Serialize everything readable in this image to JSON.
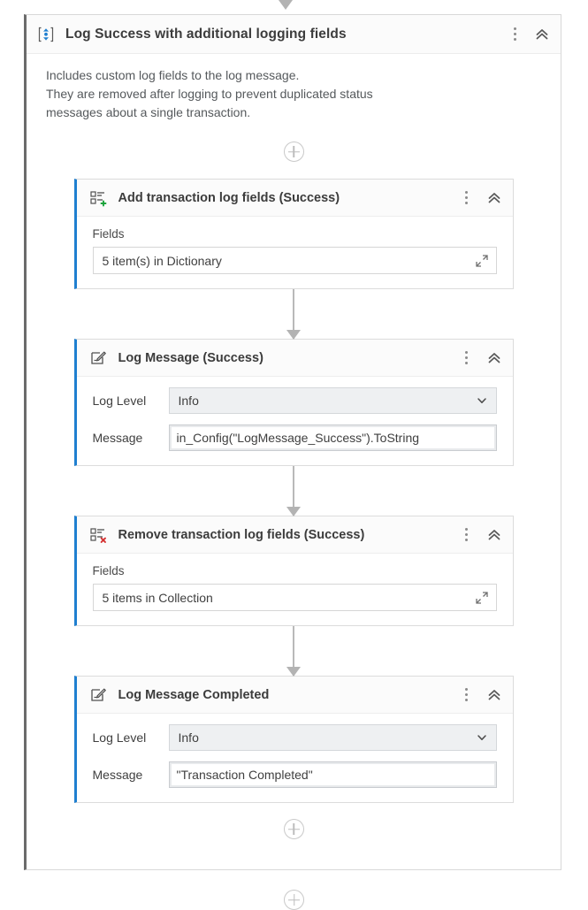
{
  "sequence": {
    "icon": "sequence-icon",
    "title": "Log Success with additional logging fields",
    "menu_icon": "kebab-menu-icon",
    "collapse_icon": "double-chevron-up-icon",
    "description_lines": [
      "Includes custom log fields to the log message.",
      "They are removed after logging to prevent duplicated status",
      "messages about a single transaction."
    ],
    "add_activity_label": "+"
  },
  "accent_color": "#1f7fd0",
  "activities": [
    {
      "id": "add-transaction-log-fields",
      "icon": "add-log-fields-icon",
      "title": "Add transaction log fields (Success)",
      "menu_icon": "kebab-menu-icon",
      "collapse_icon": "double-chevron-up-icon",
      "field_label": "Fields",
      "field_value": "5 item(s) in Dictionary",
      "expand_icon": "open-editor-icon"
    },
    {
      "id": "log-message-success",
      "icon": "log-message-icon",
      "title": "Log Message (Success)",
      "menu_icon": "kebab-menu-icon",
      "collapse_icon": "double-chevron-up-icon",
      "log_level_label": "Log Level",
      "log_level_value": "Info",
      "dropdown_icon": "chevron-down-icon",
      "message_label": "Message",
      "message_value": "in_Config(\"LogMessage_Success\").ToString"
    },
    {
      "id": "remove-transaction-log-fields",
      "icon": "remove-log-fields-icon",
      "title": "Remove transaction log fields (Success)",
      "menu_icon": "kebab-menu-icon",
      "collapse_icon": "double-chevron-up-icon",
      "field_label": "Fields",
      "field_value": "5 items in Collection",
      "expand_icon": "open-editor-icon"
    },
    {
      "id": "log-message-completed",
      "icon": "log-message-icon",
      "title": "Log Message Completed",
      "menu_icon": "kebab-menu-icon",
      "collapse_icon": "double-chevron-up-icon",
      "log_level_label": "Log Level",
      "log_level_value": "Info",
      "dropdown_icon": "chevron-down-icon",
      "message_label": "Message",
      "message_value": "\"Transaction Completed\""
    }
  ]
}
